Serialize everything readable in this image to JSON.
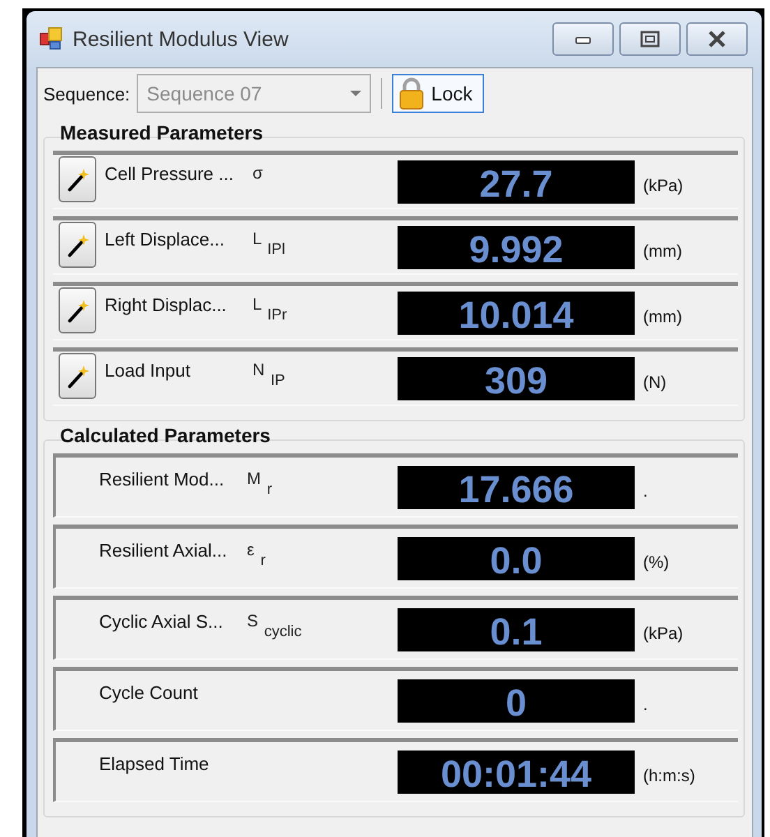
{
  "window": {
    "title": "Resilient Modulus View"
  },
  "toolbar": {
    "sequence_label": "Sequence:",
    "sequence": {
      "value": "Sequence 07",
      "disabled": true
    },
    "lock_button": "Lock"
  },
  "groups": [
    {
      "title": "Measured Parameters",
      "rows": [
        {
          "kind": "measured",
          "label": "Cell Pressure ...",
          "symbol": "σ",
          "value": "27.7",
          "unit": "(kPa)"
        },
        {
          "kind": "measured",
          "label": "Left Displace...",
          "symbol": "L $_{IPl}$",
          "value": "9.992",
          "unit": "(mm)"
        },
        {
          "kind": "measured",
          "label": "Right Displac...",
          "symbol": "L $_{IPr}$",
          "value": "10.014",
          "unit": "(mm)"
        },
        {
          "kind": "measured",
          "label": "Load Input",
          "symbol": "N $_{IP}$",
          "value": "309",
          "unit": "(N)"
        }
      ]
    },
    {
      "title": "Calculated Parameters",
      "rows": [
        {
          "kind": "calculated",
          "label": "Resilient Mod...",
          "symbol": "M $_{r}$",
          "value": "17.666",
          "unit": "."
        },
        {
          "kind": "calculated",
          "label": "Resilient Axial...",
          "symbol": "ε $_{r}$",
          "value": "0.0",
          "unit": "(%)"
        },
        {
          "kind": "calculated",
          "label": "Cyclic Axial S...",
          "symbol": "S $_{cyclic}$",
          "value": "0.1",
          "unit": "(kPa)"
        },
        {
          "kind": "calculated",
          "label": "Cycle Count",
          "value": "0",
          "unit": "."
        },
        {
          "kind": "calculated",
          "label": "Elapsed Time",
          "value": "00:01:44",
          "unit": "(h:m:s)"
        }
      ]
    }
  ]
}
